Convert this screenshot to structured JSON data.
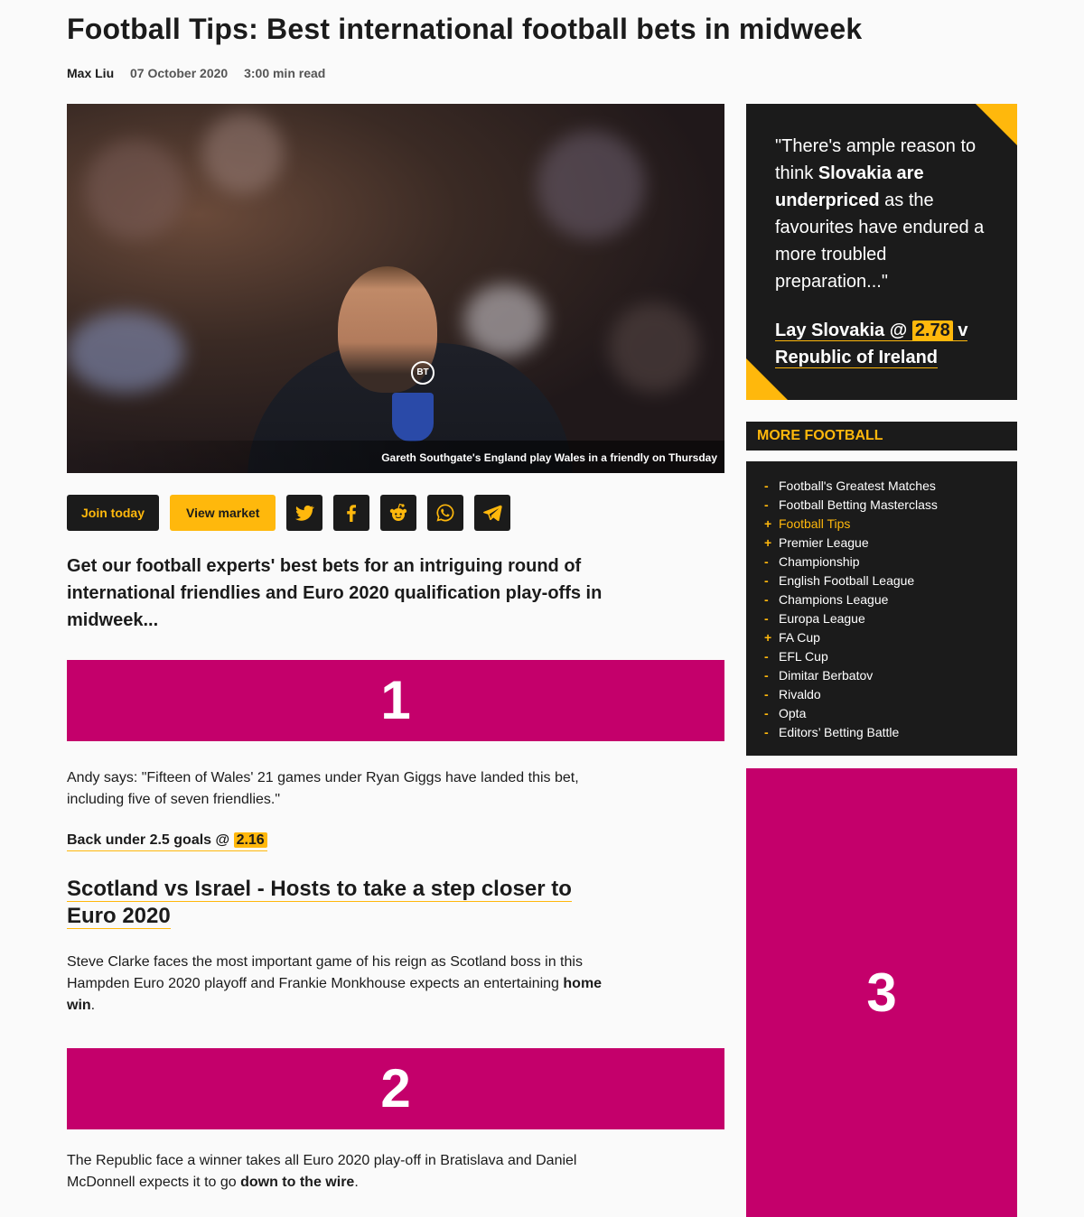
{
  "article": {
    "title": "Football Tips: Best international football bets in midweek",
    "author": "Max Liu",
    "date": "07 October 2020",
    "read_time": "3:00 min read",
    "image_caption": "Gareth Southgate's England play Wales in a friendly on Thursday",
    "intro": "Get our football experts' best bets for an intriguing round of international friendlies and Euro 2020 qualification play-offs in midweek..."
  },
  "actions": {
    "join_label": "Join today",
    "market_label": "View market",
    "share_icons": [
      "twitter-icon",
      "facebook-icon",
      "reddit-icon",
      "whatsapp-icon",
      "telegram-icon"
    ]
  },
  "blocks": {
    "one": "1",
    "two": "2",
    "three": "3"
  },
  "section1": {
    "quote": "Andy says: \"Fifteen of Wales' 21 games under Ryan Giggs have landed this bet, including five of seven friendlies.\"",
    "bet_prefix": "Back under 2.5 goals @",
    "bet_odds": "2.16"
  },
  "section2": {
    "heading": "Scotland vs Israel - Hosts to take a step closer to Euro 2020",
    "text_before": "Steve Clarke faces the most important game of his reign as Scotland boss in this Hampden Euro 2020 playoff and Frankie Monkhouse expects an entertaining ",
    "text_bold": "home win",
    "text_after": "."
  },
  "section3": {
    "text_before": "The Republic face a winner takes all Euro 2020 play-off in Bratislava and Daniel McDonnell expects it to go ",
    "text_bold": "down to the wire",
    "text_after": "."
  },
  "sidebar": {
    "quote_open": "\"There's ample reason to think ",
    "quote_bold": "Slovakia are underpriced",
    "quote_close": " as the favourites have endured a more troubled preparation...\"",
    "cta_prefix": "Lay Slovakia @",
    "cta_odds": "2.78",
    "cta_suffix": "v Republic of Ireland",
    "more_title": "MORE FOOTBALL",
    "more_items": [
      {
        "marker": "-",
        "label": "Football's Greatest Matches"
      },
      {
        "marker": "-",
        "label": "Football Betting Masterclass"
      },
      {
        "marker": "+",
        "label": "Football Tips"
      },
      {
        "marker": "+",
        "label": "Premier League"
      },
      {
        "marker": "-",
        "label": "Championship"
      },
      {
        "marker": "-",
        "label": "English Football League"
      },
      {
        "marker": "-",
        "label": "Champions League"
      },
      {
        "marker": "-",
        "label": "Europa League"
      },
      {
        "marker": "+",
        "label": "FA Cup"
      },
      {
        "marker": "-",
        "label": "EFL Cup"
      },
      {
        "marker": "-",
        "label": "Dimitar Berbatov"
      },
      {
        "marker": "-",
        "label": "Rivaldo"
      },
      {
        "marker": "-",
        "label": "Opta"
      },
      {
        "marker": "-",
        "label": "Editors’ Betting Battle"
      }
    ]
  },
  "colors": {
    "accent": "#ffb80c",
    "dark": "#1b1b1b",
    "magenta": "#c4006b"
  }
}
